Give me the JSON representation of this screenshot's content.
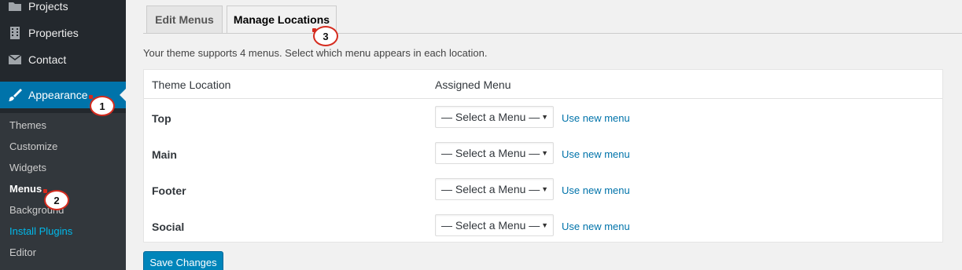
{
  "sidebar": {
    "items": [
      {
        "label": "Projects",
        "icon": "folder-icon"
      },
      {
        "label": "Properties",
        "icon": "building-icon"
      },
      {
        "label": "Contact",
        "icon": "envelope-icon"
      },
      {
        "label": "Appearance",
        "icon": "paintbrush-icon"
      }
    ],
    "submenu": [
      "Themes",
      "Customize",
      "Widgets",
      "Menus",
      "Background",
      "Install Plugins",
      "Editor"
    ]
  },
  "tabs": [
    {
      "label": "Edit Menus"
    },
    {
      "label": "Manage Locations"
    }
  ],
  "intro": "Your theme supports 4 menus. Select which menu appears in each location.",
  "table": {
    "headers": {
      "location": "Theme Location",
      "menu": "Assigned Menu"
    },
    "rows": [
      {
        "location": "Top",
        "select": "— Select a Menu —",
        "link": "Use new menu"
      },
      {
        "location": "Main",
        "select": "— Select a Menu —",
        "link": "Use new menu"
      },
      {
        "location": "Footer",
        "select": "— Select a Menu —",
        "link": "Use new menu"
      },
      {
        "location": "Social",
        "select": "— Select a Menu —",
        "link": "Use new menu"
      }
    ]
  },
  "save_label": "Save Changes",
  "callouts": [
    "1",
    "2",
    "3"
  ],
  "colors": {
    "accent": "#0073aa",
    "sidebar": "#23282d",
    "callout": "#d52b1e"
  }
}
